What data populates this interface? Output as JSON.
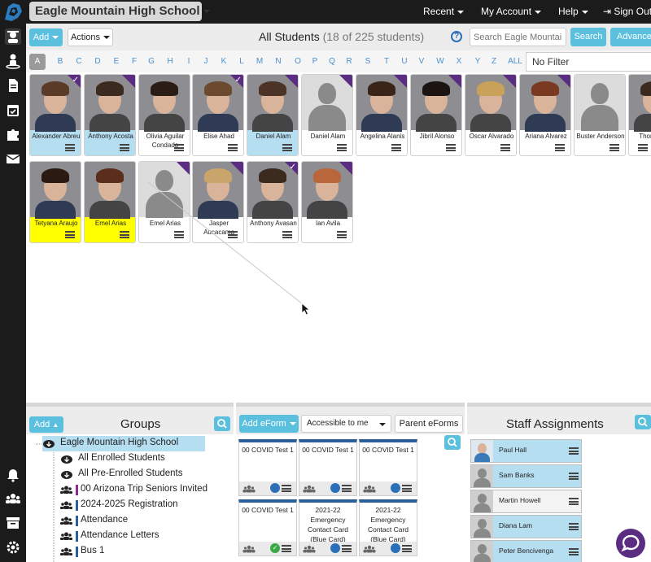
{
  "header": {
    "school": "Eagle Mountain High School",
    "nav": [
      "Recent",
      "My Account",
      "Help",
      "Sign Out"
    ]
  },
  "sidebar": {
    "icons": [
      "students-icon",
      "person-icon",
      "document-icon",
      "calendar-icon",
      "puzzle-icon",
      "mail-icon",
      "bell-icon",
      "group-icon",
      "archive-icon",
      "gear-icon"
    ]
  },
  "toolbar": {
    "add_label": "Add",
    "actions_label": "Actions",
    "title": "All Students",
    "count": "(18 of 225 students)",
    "help_label": "?",
    "search_placeholder": "Search Eagle Mountain",
    "search_label": "Search",
    "advanced_label": "Advanced"
  },
  "letters": [
    "A",
    "B",
    "C",
    "D",
    "E",
    "F",
    "G",
    "H",
    "I",
    "J",
    "K",
    "L",
    "M",
    "N",
    "O",
    "P",
    "Q",
    "R",
    "S",
    "T",
    "U",
    "V",
    "W",
    "X",
    "Y",
    "Z",
    "ALL"
  ],
  "filter": "No Filter",
  "students": [
    {
      "name": "Alexander Abreu",
      "bg": "sel",
      "photo": true,
      "corner": true,
      "check": true
    },
    {
      "name": "Anthony Acosta",
      "bg": "sel",
      "photo": true,
      "corner": true,
      "check": false
    },
    {
      "name": "Olivia Aguilar Condado",
      "bg": "",
      "photo": true,
      "corner": false,
      "check": false
    },
    {
      "name": "Elise Ahad",
      "bg": "",
      "photo": true,
      "corner": true,
      "check": true
    },
    {
      "name": "Daniel Alam",
      "bg": "sel",
      "photo": true,
      "corner": true,
      "check": false
    },
    {
      "name": "Daniel Alam",
      "bg": "",
      "photo": false,
      "corner": true,
      "check": false
    },
    {
      "name": "Angelina Alanis",
      "bg": "",
      "photo": true,
      "corner": true,
      "check": false
    },
    {
      "name": "Jibril Alonso",
      "bg": "",
      "photo": true,
      "corner": true,
      "check": false
    },
    {
      "name": "Oscar Alvarado",
      "bg": "",
      "photo": true,
      "corner": true,
      "check": false
    },
    {
      "name": "Ariana Alvarez",
      "bg": "",
      "photo": true,
      "corner": true,
      "check": false
    },
    {
      "name": "Buster Anderson",
      "bg": "",
      "photo": false,
      "corner": false,
      "check": false
    },
    {
      "name": "Thomas Ja",
      "bg": "",
      "photo": true,
      "corner": false,
      "check": false
    },
    {
      "name": "Tetyana Araujo",
      "bg": "yel",
      "photo": true,
      "corner": false,
      "check": false
    },
    {
      "name": "Emel Arias",
      "bg": "yel",
      "photo": true,
      "corner": false,
      "check": false
    },
    {
      "name": "Emel Arias",
      "bg": "",
      "photo": false,
      "corner": true,
      "check": false
    },
    {
      "name": "Jasper Aucacama",
      "bg": "",
      "photo": true,
      "corner": true,
      "check": false
    },
    {
      "name": "Anthony Avasan",
      "bg": "",
      "photo": true,
      "corner": true,
      "check": true
    },
    {
      "name": "Ian Avila",
      "bg": "",
      "photo": true,
      "corner": true,
      "check": false
    }
  ],
  "groups": {
    "add_label": "Add",
    "title": "Groups",
    "root": "Eagle Mountain High School",
    "items": [
      {
        "label": "All Enrolled Students",
        "color": ""
      },
      {
        "label": "All Pre-Enrolled Students",
        "color": ""
      },
      {
        "label": "00 Arizona Trip Seniors Invited",
        "color": "#8e2b8c"
      },
      {
        "label": "2024-2025 Registration",
        "color": "#2c5f99"
      },
      {
        "label": "Attendance",
        "color": "#2c5f99"
      },
      {
        "label": "Attendance Letters",
        "color": "#2c5f99"
      },
      {
        "label": "Bus 1",
        "color": "#2c5f99"
      }
    ]
  },
  "eforms": {
    "add_label": "Add eForm",
    "access_label": "Accessible to me",
    "parent_label": "Parent eForms",
    "items": [
      {
        "name": "00 COVID Test 1",
        "status": "pause"
      },
      {
        "name": "00 COVID Test 1",
        "status": "pause"
      },
      {
        "name": "00 COVID Test 1",
        "status": "pause"
      },
      {
        "name": "00 COVID Test 1",
        "status": "check"
      },
      {
        "name": "2021-22 Emergency Contact Card (Blue Card)",
        "status": "pause"
      },
      {
        "name": "2021-22 Emergency Contact Card (Blue Card)",
        "status": "pause"
      }
    ]
  },
  "staff": {
    "title": "Staff Assignments",
    "items": [
      {
        "name": "Paul Hall",
        "sel": true
      },
      {
        "name": "Sam Banks",
        "sel": true
      },
      {
        "name": "Martin Howell",
        "sel": false
      },
      {
        "name": "Diana Lam",
        "sel": true
      },
      {
        "name": "Peter Bencivenga",
        "sel": true
      }
    ]
  }
}
